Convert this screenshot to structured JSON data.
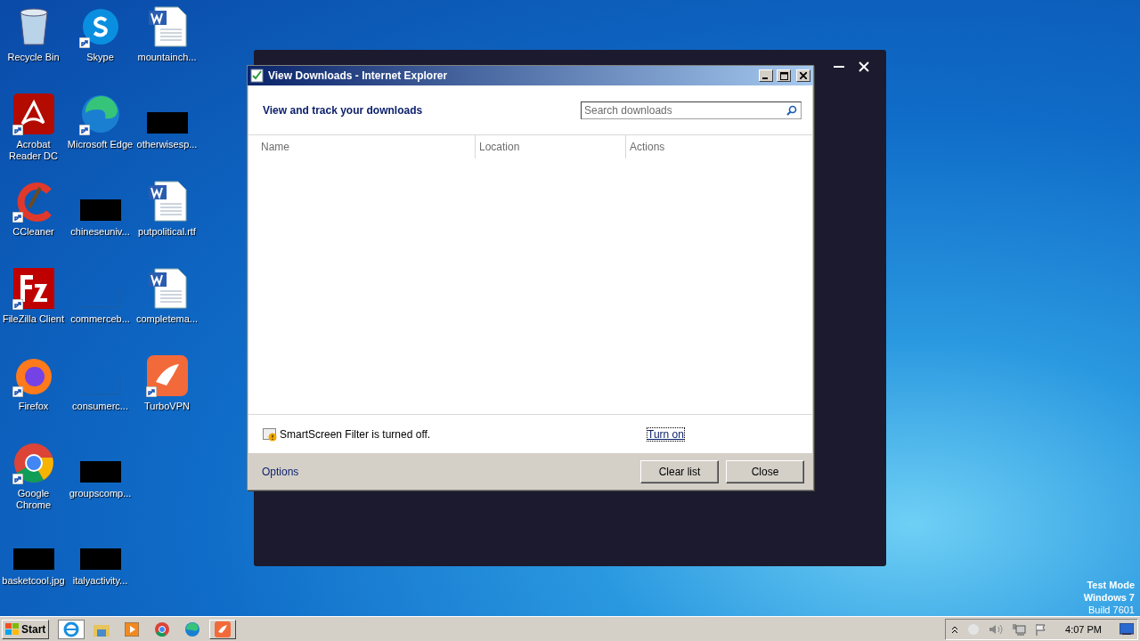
{
  "desktop": {
    "icons": [
      {
        "label": "Recycle Bin",
        "kind": "recycle",
        "shortcut": false
      },
      {
        "label": "Acrobat Reader DC",
        "kind": "acrobat",
        "shortcut": true
      },
      {
        "label": "CCleaner",
        "kind": "ccleaner",
        "shortcut": true
      },
      {
        "label": "FileZilla Client",
        "kind": "filezilla",
        "shortcut": true
      },
      {
        "label": "Firefox",
        "kind": "firefox",
        "shortcut": true
      },
      {
        "label": "Google Chrome",
        "kind": "chrome",
        "shortcut": true
      },
      {
        "label": "basketcool.jpg",
        "kind": "redacted",
        "shortcut": false
      },
      {
        "label": "Skype",
        "kind": "skype",
        "shortcut": true
      },
      {
        "label": "Microsoft Edge",
        "kind": "edge",
        "shortcut": true
      },
      {
        "label": "chineseuniv...",
        "kind": "redacted",
        "shortcut": false
      },
      {
        "label": "commerceb...",
        "kind": "blank",
        "shortcut": false
      },
      {
        "label": "consumerc...",
        "kind": "blank",
        "shortcut": false
      },
      {
        "label": "groupscomp...",
        "kind": "redacted",
        "shortcut": false
      },
      {
        "label": "italyactivity...",
        "kind": "redacted",
        "shortcut": false
      },
      {
        "label": "mountainch...",
        "kind": "word",
        "shortcut": false
      },
      {
        "label": "otherwisesp...",
        "kind": "redacted",
        "shortcut": false
      },
      {
        "label": "putpolitical.rtf",
        "kind": "word",
        "shortcut": false
      },
      {
        "label": "completema...",
        "kind": "word",
        "shortcut": false
      },
      {
        "label": "TurboVPN",
        "kind": "turbovpn",
        "shortcut": true
      }
    ]
  },
  "dialog": {
    "title": "View Downloads - Internet Explorer",
    "heading": "View and track your downloads",
    "search": {
      "placeholder": "Search downloads"
    },
    "columns": [
      "Name",
      "Location",
      "Actions"
    ],
    "smartscreen": {
      "message": "SmartScreen Filter is turned off.",
      "link": "Turn on"
    },
    "options_link": "Options",
    "buttons": [
      "Clear list",
      "Close"
    ]
  },
  "taskbar": {
    "start": "Start",
    "items": [
      {
        "kind": "ie",
        "selected": true,
        "open": false
      },
      {
        "kind": "explorer",
        "selected": false,
        "open": false
      },
      {
        "kind": "media",
        "selected": false,
        "open": false
      },
      {
        "kind": "chrome",
        "selected": false,
        "open": false
      },
      {
        "kind": "edge",
        "selected": false,
        "open": false
      },
      {
        "kind": "turbovpn",
        "selected": false,
        "open": true
      }
    ],
    "clock": "4:07 PM"
  },
  "watermark": {
    "lines": [
      "Test Mode",
      "Windows 7",
      "Build 7601"
    ]
  }
}
